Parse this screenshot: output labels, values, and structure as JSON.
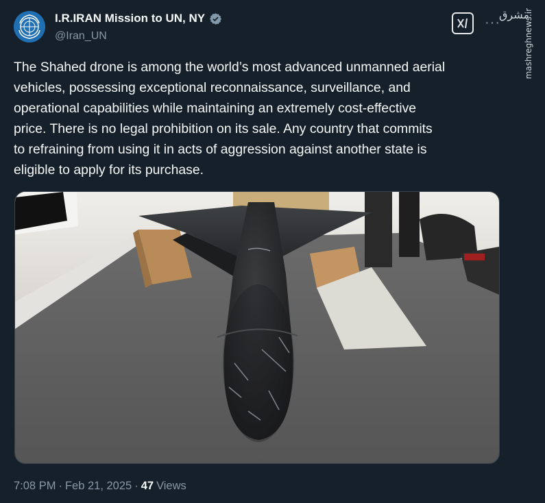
{
  "account": {
    "display_name": "I.R.IRAN Mission to UN, NY",
    "handle": "@Iran_UN",
    "verified_icon": "verified-badge-icon",
    "avatar_icon": "un-emblem-icon"
  },
  "header_icons": {
    "grok": "grok-icon",
    "more": "···"
  },
  "watermark": {
    "logo_text": "مشرق",
    "site": "mashreghnews.ir"
  },
  "tweet": {
    "text": "The Shahed drone is among the world’s most advanced unmanned aerial\nvehicles, possessing exceptional reconnaissance, surveillance, and\noperational capabilities while maintaining an extremely cost-effective\nprice. There is no legal prohibition on its sale. Any country that commits\nto refraining from using it in acts of aggression against another state is\neligible to apply for its purchase."
  },
  "meta": {
    "time": "7:08 PM",
    "sep1": "·",
    "date": "Feb 21, 2025",
    "sep2": "·",
    "views_count": "47",
    "views_label": "Views"
  },
  "colors": {
    "background": "#15202b",
    "text": "#f7f9f9",
    "secondary": "#8b98a5",
    "verified": "#829aab"
  }
}
